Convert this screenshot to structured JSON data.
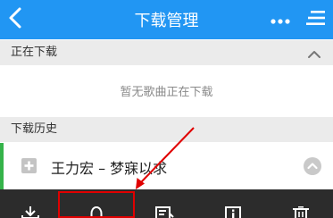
{
  "header": {
    "title": "下载管理"
  },
  "downloading": {
    "label": "正在下载",
    "empty_message": "暂无歌曲正在下载"
  },
  "history": {
    "label": "下载历史",
    "items": [
      {
        "title": "王力宏 – 梦寐以求"
      }
    ]
  },
  "toolbar": {
    "buttons": [
      {
        "icon": "download-icon"
      },
      {
        "icon": "bell-icon"
      },
      {
        "icon": "edit-list-icon"
      },
      {
        "icon": "info-icon"
      },
      {
        "icon": "trash-icon"
      }
    ]
  },
  "colors": {
    "header_bg": "#2196f3",
    "toolbar_bg": "#2c2c2c",
    "accent_green": "#35b34a",
    "annotation_red": "#e00000"
  }
}
